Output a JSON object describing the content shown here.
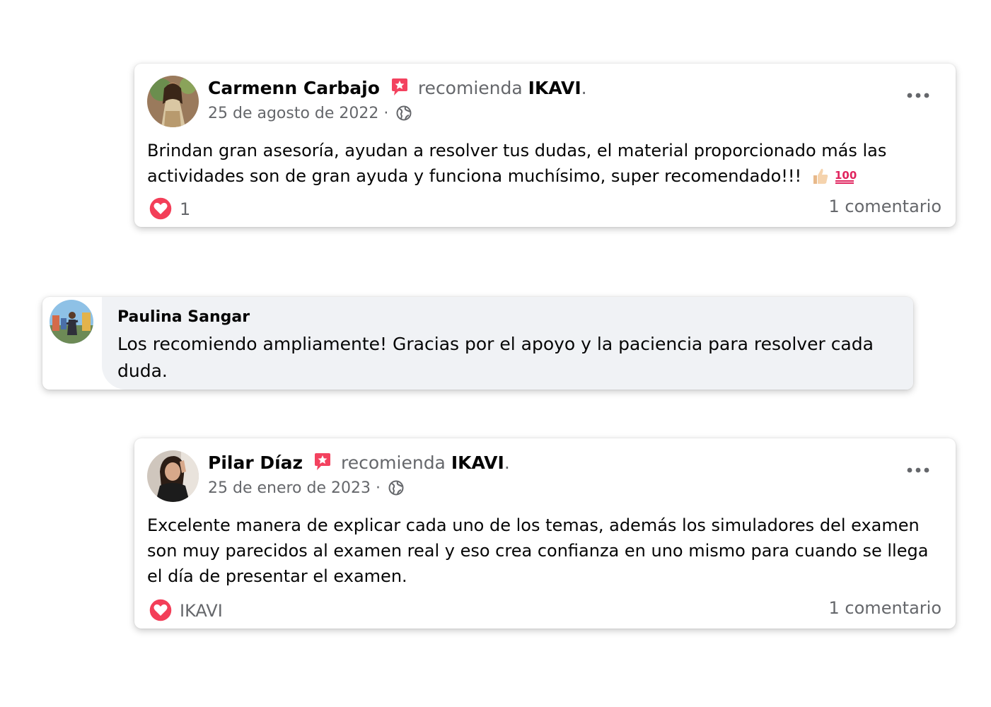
{
  "posts": [
    {
      "author": "Carmenn Carbajo",
      "action": "recomienda",
      "page": "IKAVI",
      "date": "25 de agosto de 2022",
      "separator": "·",
      "text": "Brindan gran asesoría, ayudan a resolver tus dudas, el material proporcionado más las actividades son de gran ayuda y funciona muchísimo, super recomendado!!!",
      "reaction": "1",
      "comments": "1 comentario"
    },
    {
      "author": "Pilar Díaz",
      "action": "recomienda",
      "page": "IKAVI",
      "date": "25 de enero de 2023",
      "separator": "·",
      "text": "Excelente manera de explicar cada uno de los temas, además los simuladores del examen son muy parecidos al examen real y eso crea confianza en uno mismo para cuando se llega el día de presentar el examen.",
      "reaction": "IKAVI",
      "comments": "1 comentario"
    }
  ],
  "comment": {
    "author": "Paulina Sangar",
    "text": "Los recomiendo ampliamente! Gracias por el apoyo y la paciencia para resolver cada duda."
  },
  "icons": {
    "recommend": "recommend-star-icon",
    "audience": "globe-icon",
    "menu": "more-options-icon",
    "reaction": "love-reaction-icon",
    "emoji": [
      "thumbs-up-emoji-icon",
      "hundred-points-emoji-icon"
    ]
  },
  "colors": {
    "recommend_red": "#f3425f",
    "love_red": "#f33e58",
    "secondary_text": "#65676b",
    "comment_bubble": "#f0f2f5"
  }
}
